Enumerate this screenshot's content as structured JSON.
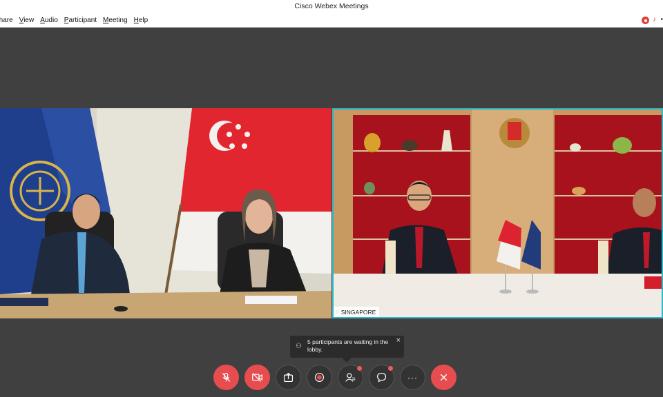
{
  "window": {
    "title": "Cisco Webex Meetings"
  },
  "menu": {
    "items": [
      "Share",
      "View",
      "Audio",
      "Participant",
      "Meeting",
      "Help"
    ]
  },
  "videos": {
    "right_label": "SINGAPORE"
  },
  "toast": {
    "message": "5 participants are waiting in the lobby.",
    "close": "×"
  },
  "controls": {
    "more": "···"
  },
  "colors": {
    "accent_border": "#2fb8c8",
    "end_button": "#e74c4f",
    "muted_button": "#e74c4f",
    "background": "#404040"
  },
  "icons": [
    "record-indicator-icon",
    "mic-indicator-icon",
    "mute-icon",
    "stop-video-icon",
    "share-icon",
    "record-icon",
    "participants-icon",
    "chat-icon",
    "more-icon",
    "end-call-icon",
    "lobby-icon",
    "close-icon"
  ]
}
